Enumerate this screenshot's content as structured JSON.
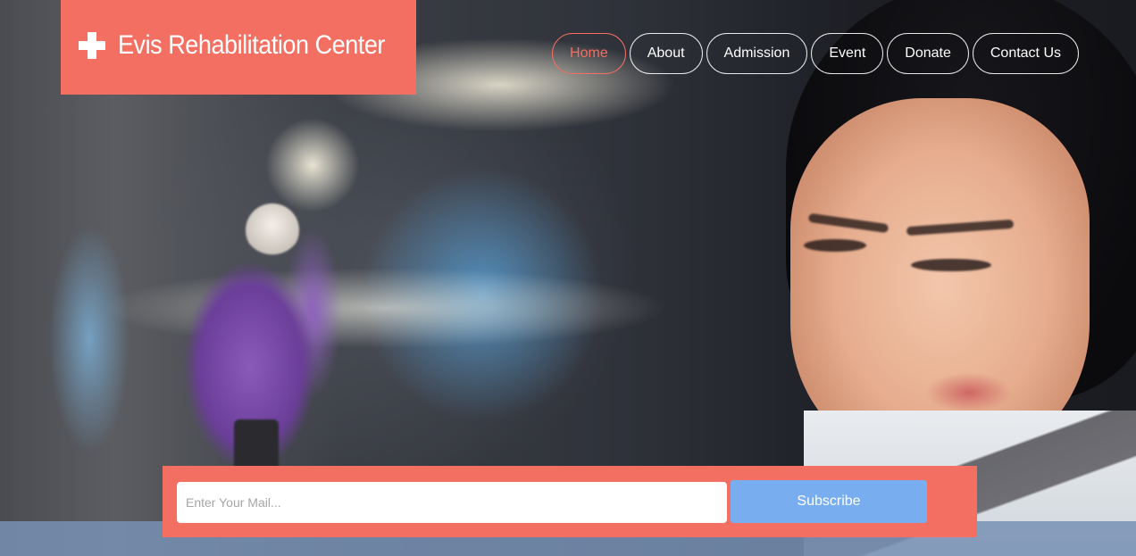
{
  "brand": {
    "name": "Evis Rehabilitation Center",
    "icon": "plus-cross-icon",
    "color": "#f36f62"
  },
  "nav": {
    "items": [
      {
        "label": "Home",
        "active": true
      },
      {
        "label": "About",
        "active": false
      },
      {
        "label": "Admission",
        "active": false
      },
      {
        "label": "Event",
        "active": false
      },
      {
        "label": "Donate",
        "active": false
      },
      {
        "label": "Contact Us",
        "active": false
      }
    ]
  },
  "subscribe": {
    "email_placeholder": "Enter Your Mail...",
    "email_value": "",
    "button_label": "Subscribe",
    "button_color": "#78aef0"
  }
}
